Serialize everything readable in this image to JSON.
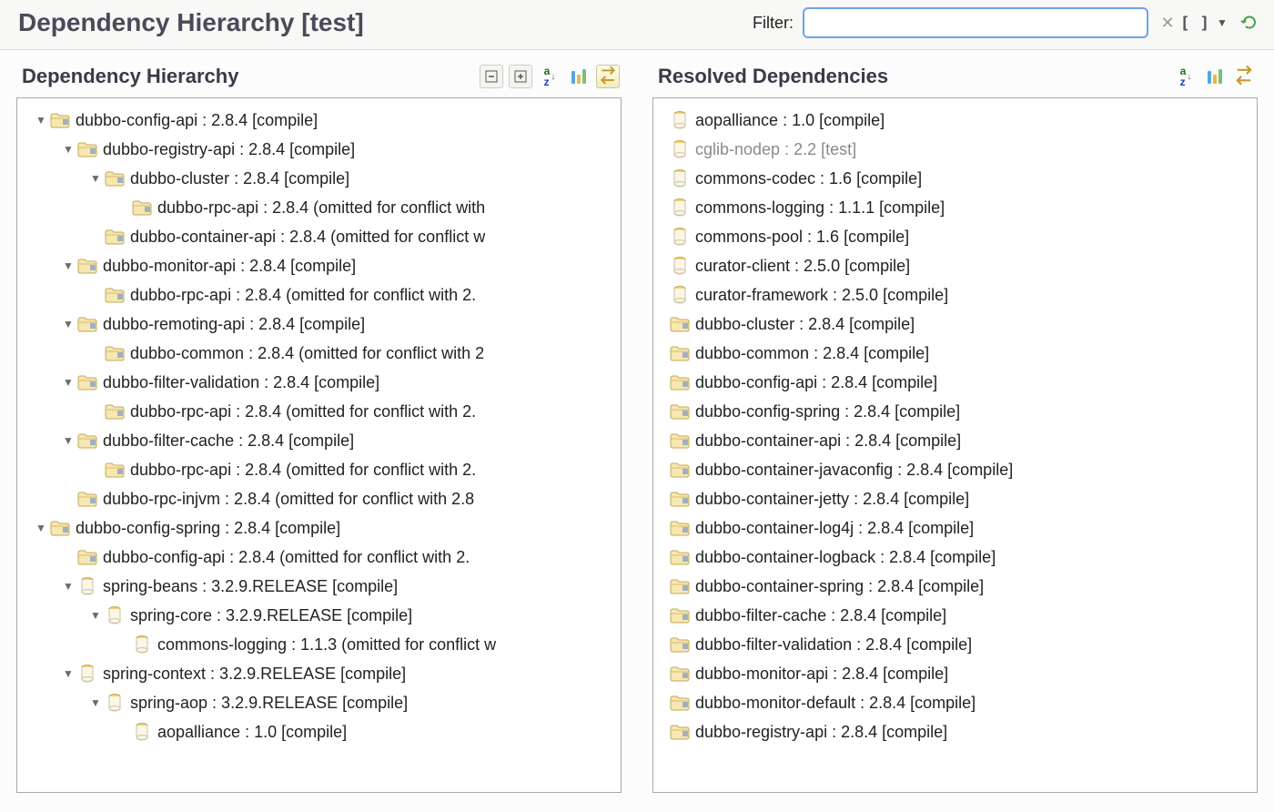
{
  "header": {
    "title": "Dependency Hierarchy [test]",
    "filter_label": "Filter:",
    "filter_value": ""
  },
  "left_panel": {
    "title": "Dependency Hierarchy"
  },
  "right_panel": {
    "title": "Resolved Dependencies"
  },
  "tree": [
    {
      "depth": 0,
      "expand": "open",
      "icon": "folder",
      "label": "dubbo-config-api : 2.8.4 [compile]"
    },
    {
      "depth": 1,
      "expand": "open",
      "icon": "folder",
      "label": "dubbo-registry-api : 2.8.4 [compile]"
    },
    {
      "depth": 2,
      "expand": "open",
      "icon": "folder",
      "label": "dubbo-cluster : 2.8.4 [compile]"
    },
    {
      "depth": 3,
      "expand": "none",
      "icon": "folder",
      "label": "dubbo-rpc-api : 2.8.4 (omitted for conflict with"
    },
    {
      "depth": 2,
      "expand": "none",
      "icon": "folder",
      "label": "dubbo-container-api : 2.8.4 (omitted for conflict w"
    },
    {
      "depth": 1,
      "expand": "open",
      "icon": "folder",
      "label": "dubbo-monitor-api : 2.8.4 [compile]"
    },
    {
      "depth": 2,
      "expand": "none",
      "icon": "folder",
      "label": "dubbo-rpc-api : 2.8.4 (omitted for conflict with 2."
    },
    {
      "depth": 1,
      "expand": "open",
      "icon": "folder",
      "label": "dubbo-remoting-api : 2.8.4 [compile]"
    },
    {
      "depth": 2,
      "expand": "none",
      "icon": "folder",
      "label": "dubbo-common : 2.8.4 (omitted for conflict with 2"
    },
    {
      "depth": 1,
      "expand": "open",
      "icon": "folder",
      "label": "dubbo-filter-validation : 2.8.4 [compile]"
    },
    {
      "depth": 2,
      "expand": "none",
      "icon": "folder",
      "label": "dubbo-rpc-api : 2.8.4 (omitted for conflict with 2."
    },
    {
      "depth": 1,
      "expand": "open",
      "icon": "folder",
      "label": "dubbo-filter-cache : 2.8.4 [compile]"
    },
    {
      "depth": 2,
      "expand": "none",
      "icon": "folder",
      "label": "dubbo-rpc-api : 2.8.4 (omitted for conflict with 2."
    },
    {
      "depth": 1,
      "expand": "none",
      "icon": "folder",
      "label": "dubbo-rpc-injvm : 2.8.4 (omitted for conflict with 2.8"
    },
    {
      "depth": 0,
      "expand": "open",
      "icon": "folder",
      "label": "dubbo-config-spring : 2.8.4 [compile]"
    },
    {
      "depth": 1,
      "expand": "none",
      "icon": "folder",
      "label": "dubbo-config-api : 2.8.4 (omitted for conflict with 2."
    },
    {
      "depth": 1,
      "expand": "open",
      "icon": "jar",
      "label": "spring-beans : 3.2.9.RELEASE [compile]"
    },
    {
      "depth": 2,
      "expand": "open",
      "icon": "jar",
      "label": "spring-core : 3.2.9.RELEASE [compile]"
    },
    {
      "depth": 3,
      "expand": "none",
      "icon": "jar",
      "label": "commons-logging : 1.1.3 (omitted for conflict w"
    },
    {
      "depth": 1,
      "expand": "open",
      "icon": "jar",
      "label": "spring-context : 3.2.9.RELEASE [compile]"
    },
    {
      "depth": 2,
      "expand": "open",
      "icon": "jar",
      "label": "spring-aop : 3.2.9.RELEASE [compile]"
    },
    {
      "depth": 3,
      "expand": "none",
      "icon": "jar",
      "label": "aopalliance : 1.0 [compile]"
    }
  ],
  "resolved": [
    {
      "icon": "jar",
      "label": "aopalliance : 1.0 [compile]",
      "dim": false
    },
    {
      "icon": "jar",
      "label": "cglib-nodep : 2.2 [test]",
      "dim": true
    },
    {
      "icon": "jar",
      "label": "commons-codec : 1.6 [compile]",
      "dim": false
    },
    {
      "icon": "jar",
      "label": "commons-logging : 1.1.1 [compile]",
      "dim": false
    },
    {
      "icon": "jar",
      "label": "commons-pool : 1.6 [compile]",
      "dim": false
    },
    {
      "icon": "jar",
      "label": "curator-client : 2.5.0 [compile]",
      "dim": false
    },
    {
      "icon": "jar",
      "label": "curator-framework : 2.5.0 [compile]",
      "dim": false
    },
    {
      "icon": "folder",
      "label": "dubbo-cluster : 2.8.4 [compile]",
      "dim": false
    },
    {
      "icon": "folder",
      "label": "dubbo-common : 2.8.4 [compile]",
      "dim": false
    },
    {
      "icon": "folder",
      "label": "dubbo-config-api : 2.8.4 [compile]",
      "dim": false
    },
    {
      "icon": "folder",
      "label": "dubbo-config-spring : 2.8.4 [compile]",
      "dim": false
    },
    {
      "icon": "folder",
      "label": "dubbo-container-api : 2.8.4 [compile]",
      "dim": false
    },
    {
      "icon": "folder",
      "label": "dubbo-container-javaconfig : 2.8.4 [compile]",
      "dim": false
    },
    {
      "icon": "folder",
      "label": "dubbo-container-jetty : 2.8.4 [compile]",
      "dim": false
    },
    {
      "icon": "folder",
      "label": "dubbo-container-log4j : 2.8.4 [compile]",
      "dim": false
    },
    {
      "icon": "folder",
      "label": "dubbo-container-logback : 2.8.4 [compile]",
      "dim": false
    },
    {
      "icon": "folder",
      "label": "dubbo-container-spring : 2.8.4 [compile]",
      "dim": false
    },
    {
      "icon": "folder",
      "label": "dubbo-filter-cache : 2.8.4 [compile]",
      "dim": false
    },
    {
      "icon": "folder",
      "label": "dubbo-filter-validation : 2.8.4 [compile]",
      "dim": false
    },
    {
      "icon": "folder",
      "label": "dubbo-monitor-api : 2.8.4 [compile]",
      "dim": false
    },
    {
      "icon": "folder",
      "label": "dubbo-monitor-default : 2.8.4 [compile]",
      "dim": false
    },
    {
      "icon": "folder",
      "label": "dubbo-registry-api : 2.8.4 [compile]",
      "dim": false
    }
  ]
}
